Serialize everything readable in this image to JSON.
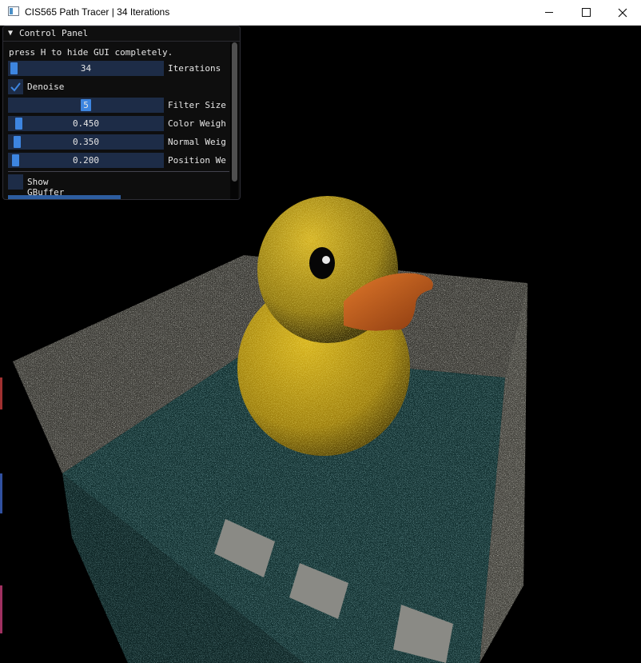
{
  "window": {
    "title": "CIS565 Path Tracer | 34 Iterations",
    "icon": "app-window-icon",
    "minimize_icon": "minimize-icon",
    "maximize_icon": "maximize-icon",
    "close_icon": "close-icon"
  },
  "panel": {
    "title": "Control Panel",
    "collapse_icon": "triangle-down-icon",
    "hint": "press H to hide GUI completely.",
    "iterations": {
      "value": "34",
      "label": "Iterations",
      "fill": 0.02
    },
    "denoise": {
      "label": "Denoise",
      "checked": true
    },
    "filter_size": {
      "value": "5",
      "label": "Filter Size",
      "fill": 0.47
    },
    "color_weight": {
      "value": "0.450",
      "label": "Color Weigh",
      "fill": 0.05
    },
    "normal_weight": {
      "value": "0.350",
      "label": "Normal Weig",
      "fill": 0.035
    },
    "position_weight": {
      "value": "0.200",
      "label": "Position We",
      "fill": 0.02
    },
    "show_gbuffer": {
      "label": "Show GBuffer",
      "checked": false
    }
  },
  "colors": {
    "accent": "#3d85e0",
    "frame_bg": "#1d2c47",
    "panel_bg": "#0f0f0f",
    "duck_yellow": "#d9b81a",
    "beak_orange": "#d9651c",
    "water_teal": "#1b3a3a"
  }
}
